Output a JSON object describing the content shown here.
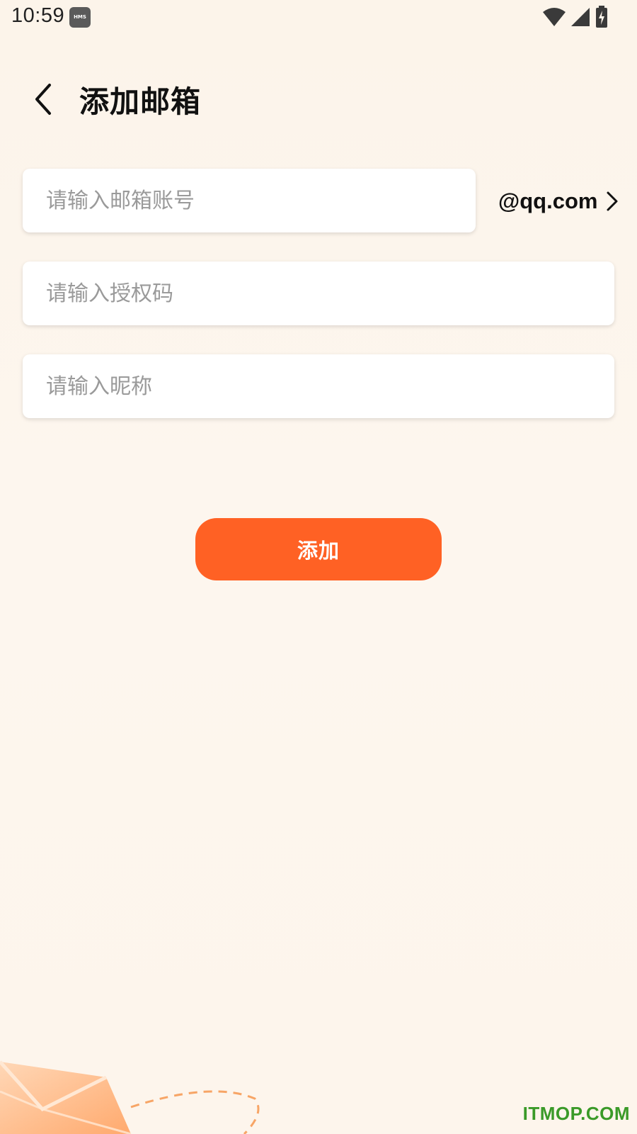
{
  "status_bar": {
    "time": "10:59",
    "badge": "HMS"
  },
  "header": {
    "title": "添加邮箱"
  },
  "form": {
    "email_placeholder": "请输入邮箱账号",
    "domain": "@qq.com",
    "auth_code_placeholder": "请输入授权码",
    "nickname_placeholder": "请输入昵称"
  },
  "actions": {
    "add_label": "添加"
  },
  "watermark": "ITMOP.COM",
  "colors": {
    "accent": "#ff6124",
    "background": "#fcf4ea",
    "watermark": "#3a9a28"
  }
}
